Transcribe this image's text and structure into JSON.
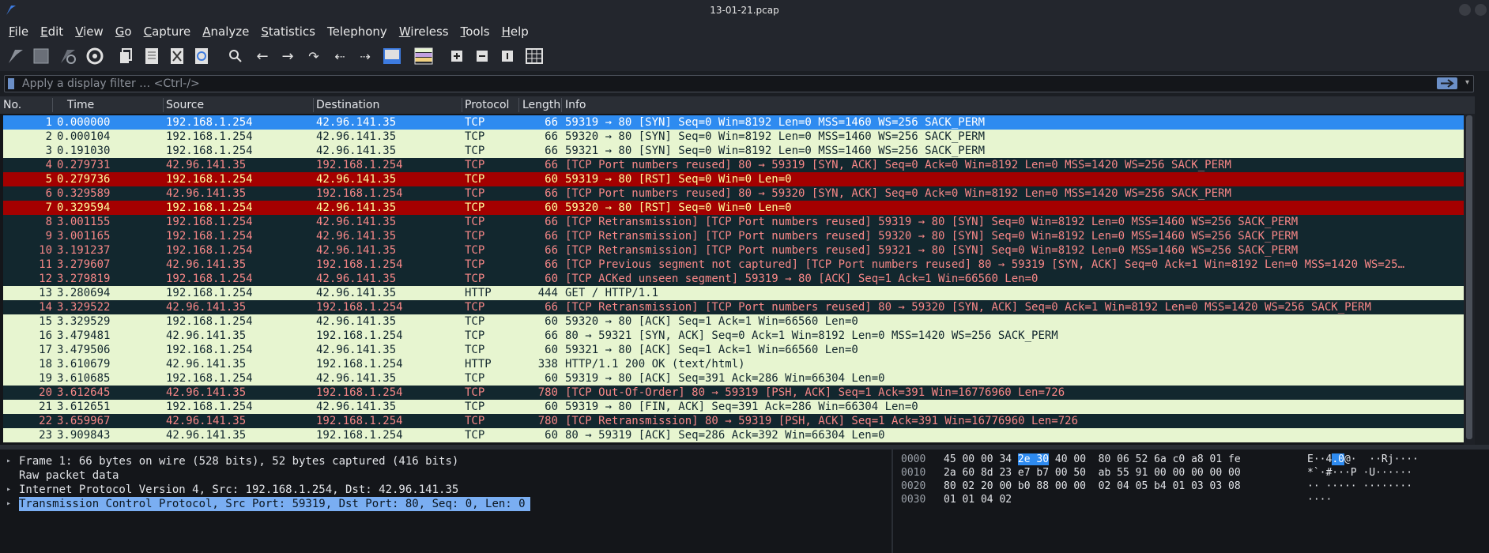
{
  "window": {
    "title": "13-01-21.pcap"
  },
  "menu": [
    {
      "key": "F",
      "rest": "ile"
    },
    {
      "key": "E",
      "rest": "dit"
    },
    {
      "key": "V",
      "rest": "iew"
    },
    {
      "key": "G",
      "rest": "o"
    },
    {
      "key": "C",
      "rest": "apture"
    },
    {
      "key": "A",
      "rest": "nalyze"
    },
    {
      "key": "S",
      "rest": "tatistics"
    },
    {
      "key": "",
      "rest": "Telephony"
    },
    {
      "key": "W",
      "rest": "ireless"
    },
    {
      "key": "T",
      "rest": "ools"
    },
    {
      "key": "H",
      "rest": "elp"
    }
  ],
  "toolbar_icons": [
    "shark-fin-start-icon",
    "stop-capture-icon",
    "restart-capture-icon",
    "capture-options-icon",
    "open-file-icon",
    "save-file-icon",
    "close-file-icon",
    "reload-file-icon",
    "find-packet-icon",
    "go-back-icon",
    "go-forward-icon",
    "go-to-packet-icon",
    "first-packet-icon",
    "last-packet-icon",
    "autoscroll-icon",
    "colorize-icon",
    "zoom-in-icon",
    "zoom-out-icon",
    "normal-size-icon",
    "resize-columns-icon"
  ],
  "filter": {
    "placeholder": "Apply a display filter … <Ctrl-/>"
  },
  "columns": {
    "no": "No.",
    "time": "Time",
    "source": "Source",
    "destination": "Destination",
    "protocol": "Protocol",
    "length": "Length",
    "info": "Info"
  },
  "packets": [
    {
      "no": "1",
      "time": "0.000000",
      "src": "192.168.1.254",
      "dst": "42.96.141.35",
      "proto": "TCP",
      "len": "66",
      "info": "59319 → 80 [SYN] Seq=0 Win=8192 Len=0 MSS=1460 WS=256 SACK_PERM",
      "style": "selected"
    },
    {
      "no": "2",
      "time": "0.000104",
      "src": "192.168.1.254",
      "dst": "42.96.141.35",
      "proto": "TCP",
      "len": "66",
      "info": "59320 → 80 [SYN] Seq=0 Win=8192 Len=0 MSS=1460 WS=256 SACK_PERM",
      "style": "tcp"
    },
    {
      "no": "3",
      "time": "0.191030",
      "src": "192.168.1.254",
      "dst": "42.96.141.35",
      "proto": "TCP",
      "len": "66",
      "info": "59321 → 80 [SYN] Seq=0 Win=8192 Len=0 MSS=1460 WS=256 SACK_PERM",
      "style": "tcp"
    },
    {
      "no": "4",
      "time": "0.279731",
      "src": "42.96.141.35",
      "dst": "192.168.1.254",
      "proto": "TCP",
      "len": "66",
      "info": "[TCP Port numbers reused] 80 → 59319 [SYN, ACK] Seq=0 Ack=0 Win=8192 Len=0 MSS=1420 WS=256 SACK_PERM",
      "style": "bad"
    },
    {
      "no": "5",
      "time": "0.279736",
      "src": "192.168.1.254",
      "dst": "42.96.141.35",
      "proto": "TCP",
      "len": "60",
      "info": "59319 → 80 [RST] Seq=0 Win=0 Len=0",
      "style": "rst"
    },
    {
      "no": "6",
      "time": "0.329589",
      "src": "42.96.141.35",
      "dst": "192.168.1.254",
      "proto": "TCP",
      "len": "66",
      "info": "[TCP Port numbers reused] 80 → 59320 [SYN, ACK] Seq=0 Ack=0 Win=8192 Len=0 MSS=1420 WS=256 SACK_PERM",
      "style": "bad"
    },
    {
      "no": "7",
      "time": "0.329594",
      "src": "192.168.1.254",
      "dst": "42.96.141.35",
      "proto": "TCP",
      "len": "60",
      "info": "59320 → 80 [RST] Seq=0 Win=0 Len=0",
      "style": "rst"
    },
    {
      "no": "8",
      "time": "3.001155",
      "src": "192.168.1.254",
      "dst": "42.96.141.35",
      "proto": "TCP",
      "len": "66",
      "info": "[TCP Retransmission] [TCP Port numbers reused] 59319 → 80 [SYN] Seq=0 Win=8192 Len=0 MSS=1460 WS=256 SACK_PERM",
      "style": "bad"
    },
    {
      "no": "9",
      "time": "3.001165",
      "src": "192.168.1.254",
      "dst": "42.96.141.35",
      "proto": "TCP",
      "len": "66",
      "info": "[TCP Retransmission] [TCP Port numbers reused] 59320 → 80 [SYN] Seq=0 Win=8192 Len=0 MSS=1460 WS=256 SACK_PERM",
      "style": "bad"
    },
    {
      "no": "10",
      "time": "3.191237",
      "src": "192.168.1.254",
      "dst": "42.96.141.35",
      "proto": "TCP",
      "len": "66",
      "info": "[TCP Retransmission] [TCP Port numbers reused] 59321 → 80 [SYN] Seq=0 Win=8192 Len=0 MSS=1460 WS=256 SACK_PERM",
      "style": "bad"
    },
    {
      "no": "11",
      "time": "3.279607",
      "src": "42.96.141.35",
      "dst": "192.168.1.254",
      "proto": "TCP",
      "len": "66",
      "info": "[TCP Previous segment not captured] [TCP Port numbers reused] 80 → 59319 [SYN, ACK] Seq=0 Ack=1 Win=8192 Len=0 MSS=1420 WS=25…",
      "style": "bad"
    },
    {
      "no": "12",
      "time": "3.279819",
      "src": "192.168.1.254",
      "dst": "42.96.141.35",
      "proto": "TCP",
      "len": "60",
      "info": "[TCP ACKed unseen segment] 59319 → 80 [ACK] Seq=1 Ack=1 Win=66560 Len=0",
      "style": "bad"
    },
    {
      "no": "13",
      "time": "3.280694",
      "src": "192.168.1.254",
      "dst": "42.96.141.35",
      "proto": "HTTP",
      "len": "444",
      "info": "GET / HTTP/1.1",
      "style": "http"
    },
    {
      "no": "14",
      "time": "3.329522",
      "src": "42.96.141.35",
      "dst": "192.168.1.254",
      "proto": "TCP",
      "len": "66",
      "info": "[TCP Retransmission] [TCP Port numbers reused] 80 → 59320 [SYN, ACK] Seq=0 Ack=1 Win=8192 Len=0 MSS=1420 WS=256 SACK_PERM",
      "style": "bad"
    },
    {
      "no": "15",
      "time": "3.329529",
      "src": "192.168.1.254",
      "dst": "42.96.141.35",
      "proto": "TCP",
      "len": "60",
      "info": "59320 → 80 [ACK] Seq=1 Ack=1 Win=66560 Len=0",
      "style": "tcp"
    },
    {
      "no": "16",
      "time": "3.479481",
      "src": "42.96.141.35",
      "dst": "192.168.1.254",
      "proto": "TCP",
      "len": "66",
      "info": "80 → 59321 [SYN, ACK] Seq=0 Ack=1 Win=8192 Len=0 MSS=1420 WS=256 SACK_PERM",
      "style": "tcp"
    },
    {
      "no": "17",
      "time": "3.479506",
      "src": "192.168.1.254",
      "dst": "42.96.141.35",
      "proto": "TCP",
      "len": "60",
      "info": "59321 → 80 [ACK] Seq=1 Ack=1 Win=66560 Len=0",
      "style": "tcp"
    },
    {
      "no": "18",
      "time": "3.610679",
      "src": "42.96.141.35",
      "dst": "192.168.1.254",
      "proto": "HTTP",
      "len": "338",
      "info": "HTTP/1.1 200 OK  (text/html)",
      "style": "http"
    },
    {
      "no": "19",
      "time": "3.610685",
      "src": "192.168.1.254",
      "dst": "42.96.141.35",
      "proto": "TCP",
      "len": "60",
      "info": "59319 → 80 [ACK] Seq=391 Ack=286 Win=66304 Len=0",
      "style": "tcp"
    },
    {
      "no": "20",
      "time": "3.612645",
      "src": "42.96.141.35",
      "dst": "192.168.1.254",
      "proto": "TCP",
      "len": "780",
      "info": "[TCP Out-Of-Order] 80 → 59319 [PSH, ACK] Seq=1 Ack=391 Win=16776960 Len=726",
      "style": "bad"
    },
    {
      "no": "21",
      "time": "3.612651",
      "src": "192.168.1.254",
      "dst": "42.96.141.35",
      "proto": "TCP",
      "len": "60",
      "info": "59319 → 80 [FIN, ACK] Seq=391 Ack=286 Win=66304 Len=0",
      "style": "tcp"
    },
    {
      "no": "22",
      "time": "3.659967",
      "src": "42.96.141.35",
      "dst": "192.168.1.254",
      "proto": "TCP",
      "len": "780",
      "info": "[TCP Retransmission] 80 → 59319 [PSH, ACK] Seq=1 Ack=391 Win=16776960 Len=726",
      "style": "bad"
    },
    {
      "no": "23",
      "time": "3.909843",
      "src": "42.96.141.35",
      "dst": "192.168.1.254",
      "proto": "TCP",
      "len": "60",
      "info": "80 → 59319 [ACK] Seq=286 Ack=392 Win=66304 Len=0",
      "style": "tcp"
    }
  ],
  "details": [
    {
      "text": "Frame 1: 66 bytes on wire (528 bits), 52 bytes captured (416 bits)",
      "expandable": true,
      "selected": false
    },
    {
      "text": "Raw packet data",
      "expandable": false,
      "selected": false
    },
    {
      "text": "Internet Protocol Version 4, Src: 192.168.1.254, Dst: 42.96.141.35",
      "expandable": true,
      "selected": false
    },
    {
      "text": "Transmission Control Protocol, Src Port: 59319, Dst Port: 80, Seq: 0, Len: 0",
      "expandable": true,
      "selected": true
    }
  ],
  "bytes": [
    {
      "offset": "0000",
      "hex_a": "45 00 00 34 ",
      "hex_hl": "2e 30",
      "hex_b": " 40 00  80 06 52 6a c0 a8 01 fe",
      "asc_a": "E··4",
      "asc_hl": ".0",
      "asc_b": "@·  ··Rj····"
    },
    {
      "offset": "0010",
      "hex_a": "2a 60 8d 23 e7 b7 00 50  ab 55 91 00 00 00 00 00",
      "hex_hl": "",
      "hex_b": "",
      "asc_a": "*`·#···P ·U······",
      "asc_hl": "",
      "asc_b": ""
    },
    {
      "offset": "0020",
      "hex_a": "80 02 20 00 b0 88 00 00  02 04 05 b4 01 03 03 08",
      "hex_hl": "",
      "hex_b": "",
      "asc_a": "·· ····· ········",
      "asc_hl": "",
      "asc_b": ""
    },
    {
      "offset": "0030",
      "hex_a": "01 01 04 02",
      "hex_hl": "",
      "hex_b": "",
      "asc_a": "····",
      "asc_hl": "",
      "asc_b": ""
    }
  ],
  "colors": {
    "tcp_bg": "#e7f5d0",
    "bad_bg": "#12272e",
    "bad_fg": "#f78787",
    "rst_bg": "#a40000",
    "rst_fg": "#fffc9c",
    "selected_bg": "#2e8bf0"
  }
}
